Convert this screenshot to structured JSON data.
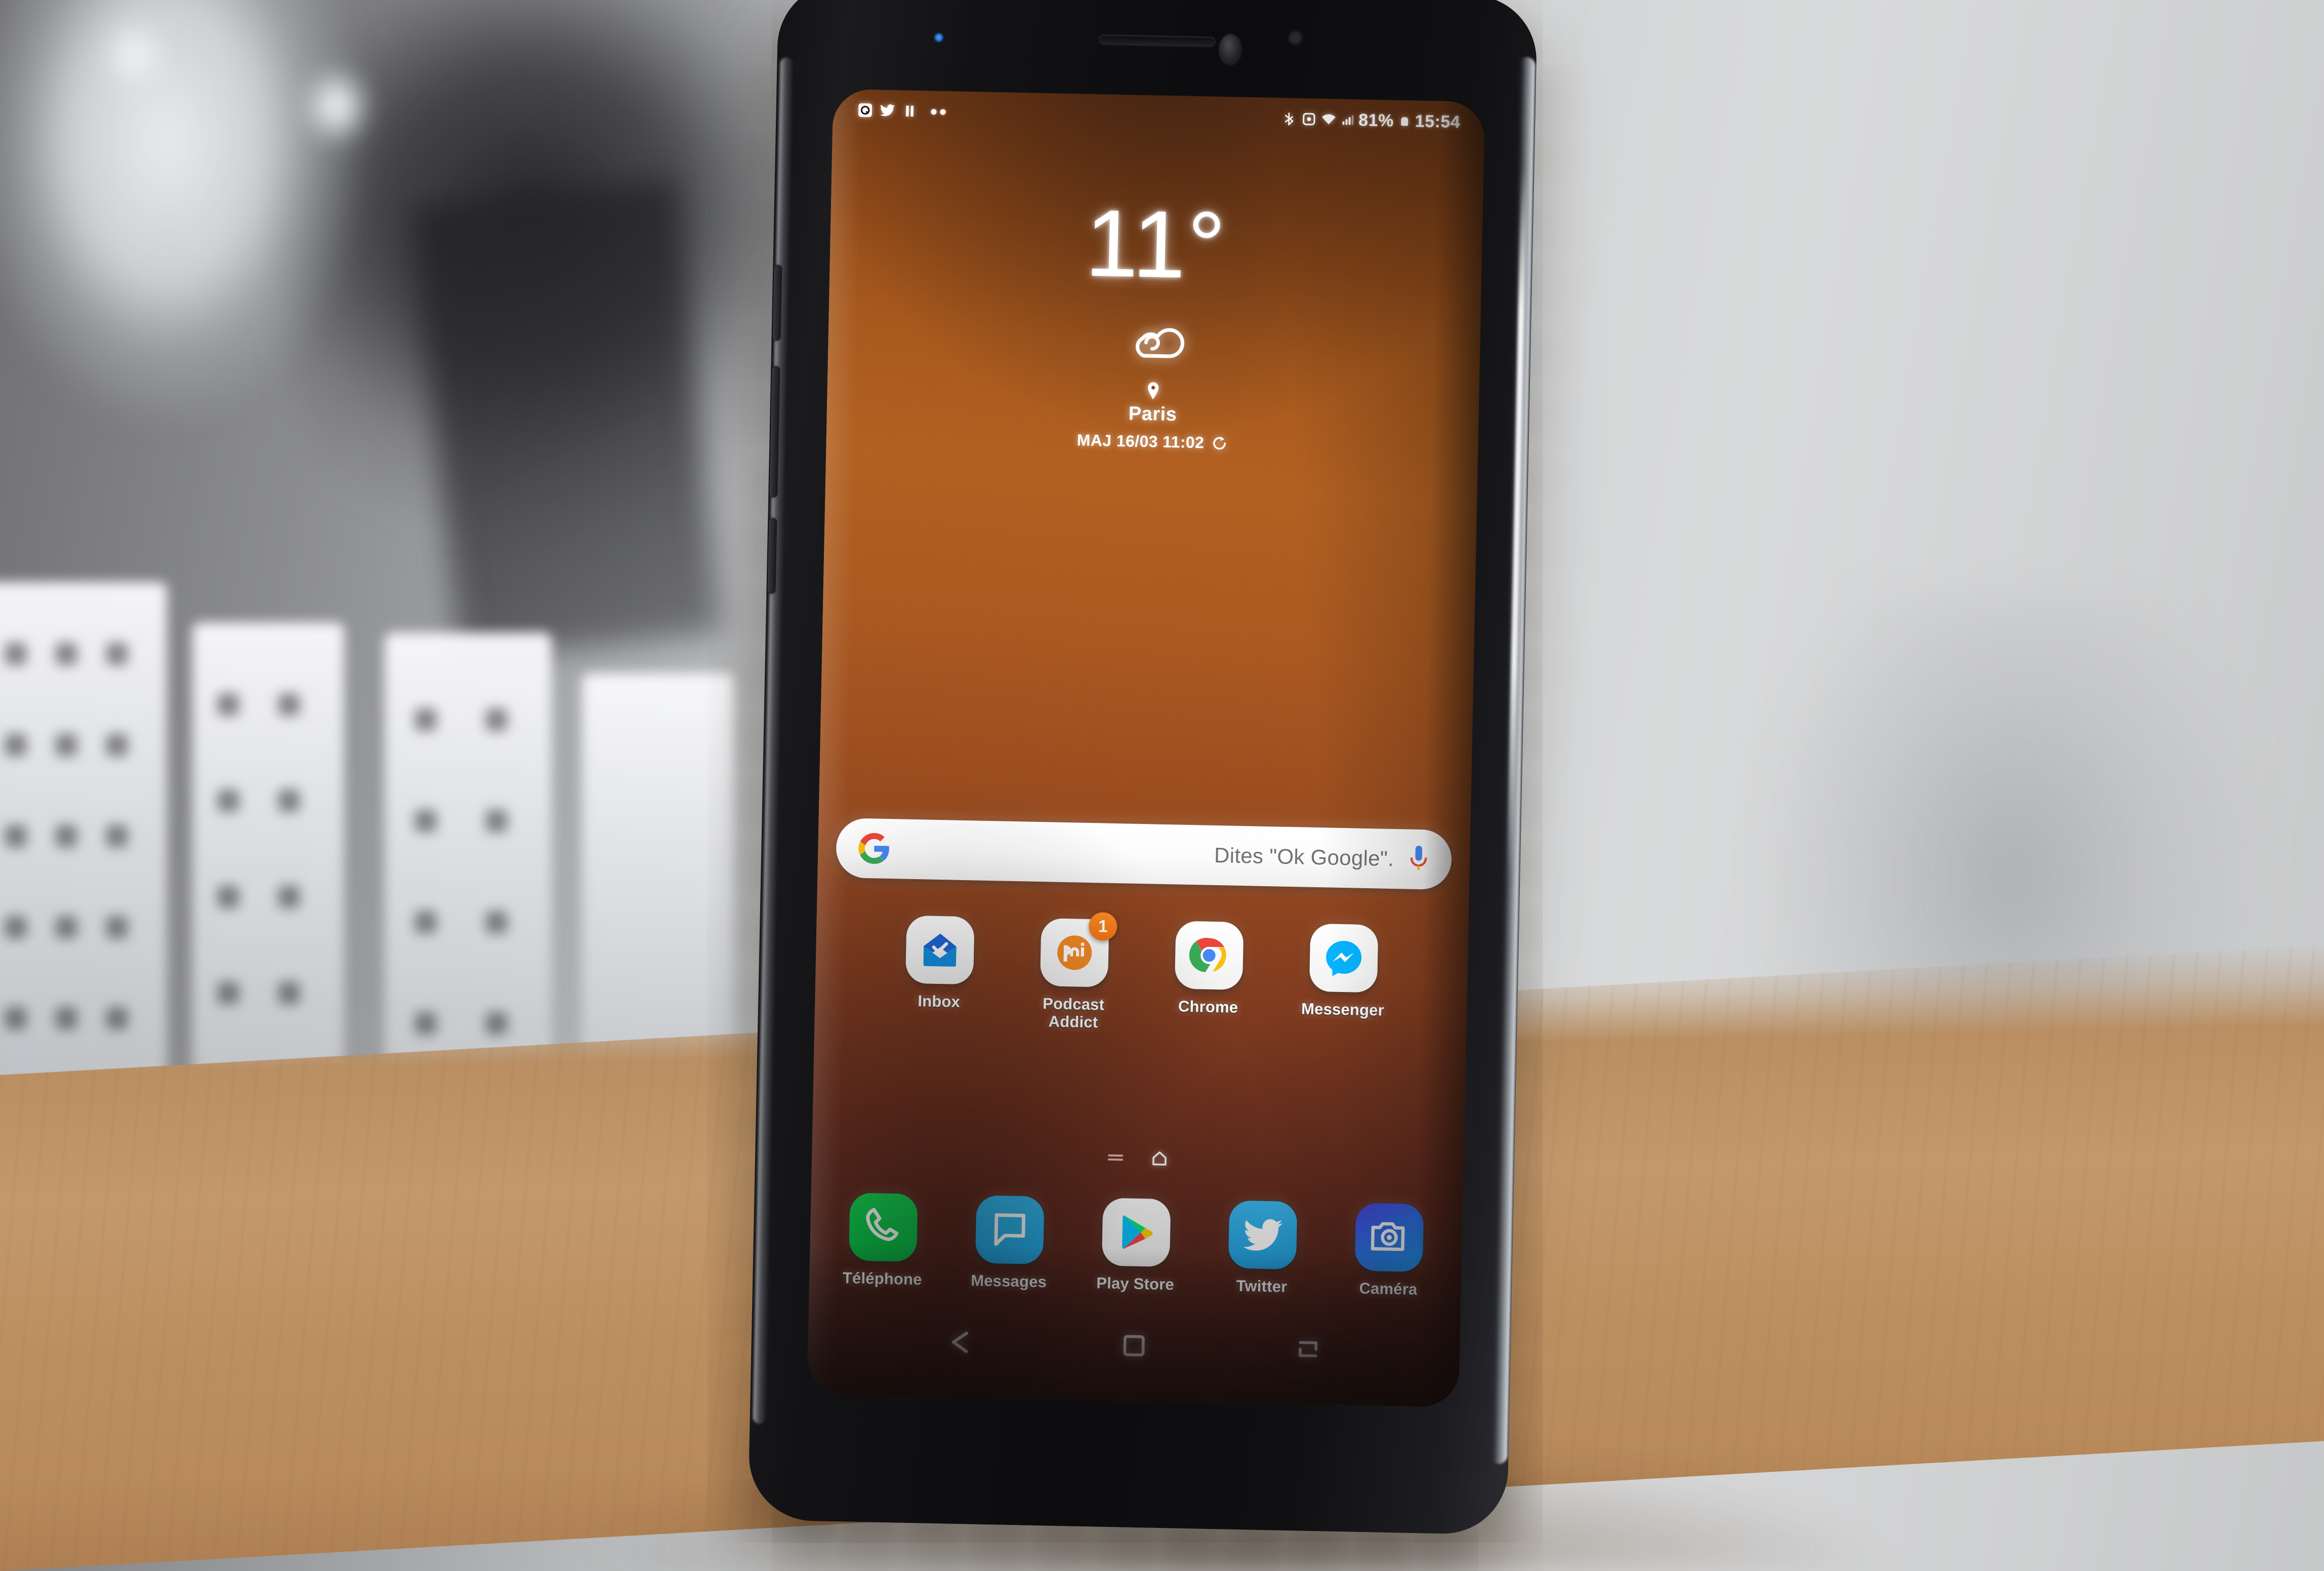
{
  "device": {
    "label": "samsung-galaxy-s9-plus",
    "scene": "phone on wooden table in kitchen"
  },
  "status_bar": {
    "notification_icons": [
      "app-q-icon",
      "twitter-icon",
      "media-pause-icon",
      "more-notifications-dots"
    ],
    "system_icons": [
      "bluetooth-icon",
      "alarm-icon",
      "wifi-icon",
      "cellular-signal-icon",
      "battery-icon"
    ],
    "battery_percent": "81%",
    "time": "15:54"
  },
  "weather_widget": {
    "temperature": "11°",
    "condition_icon": "cloud-icon",
    "location_icon": "location-pin-icon",
    "city": "Paris",
    "updated": "MAJ 16/03 11:02",
    "refresh_icon": "refresh-icon"
  },
  "search": {
    "logo": "google-g-icon",
    "placeholder": "Dites \"Ok Google\".",
    "mic_icon": "microphone-icon"
  },
  "home_screen": {
    "apps": [
      {
        "label": "Inbox",
        "icon": "inbox-icon",
        "style": "white",
        "badge": null
      },
      {
        "label": "Podcast Addict",
        "icon": "podcast-addict-icon",
        "style": "white",
        "badge": "1"
      },
      {
        "label": "Chrome",
        "icon": "chrome-icon",
        "style": "white",
        "badge": null
      },
      {
        "label": "Messenger",
        "icon": "messenger-icon",
        "style": "white",
        "badge": null
      }
    ],
    "page_indicator": {
      "dash_icon": "page-dash-icon",
      "home_icon": "home-page-icon"
    },
    "dock": [
      {
        "label": "Téléphone",
        "icon": "phone-icon",
        "style": "green"
      },
      {
        "label": "Messages",
        "icon": "messages-icon",
        "style": "cyan"
      },
      {
        "label": "Play Store",
        "icon": "play-store-icon",
        "style": "white"
      },
      {
        "label": "Twitter",
        "icon": "twitter-icon",
        "style": "twit"
      },
      {
        "label": "Caméra",
        "icon": "camera-icon",
        "style": "cam"
      }
    ]
  },
  "nav_bar": {
    "back": "back-arrow-icon",
    "home": "home-square-icon",
    "recents": "recents-icon"
  },
  "colors": {
    "wallpaper_top": "#a55518",
    "wallpaper_bottom": "#3a1713",
    "badge_orange": "#f2710a",
    "phone_green": "#0fd14e",
    "twitter_blue": "#1a9fe0",
    "wood": "#c3996c"
  }
}
